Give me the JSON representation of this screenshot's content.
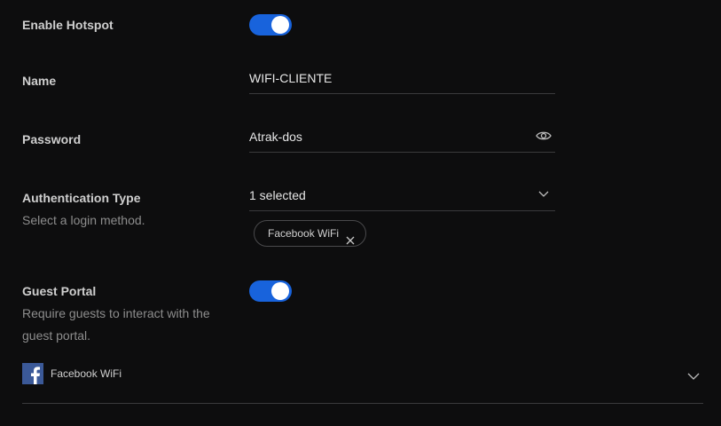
{
  "hotspot": {
    "label": "Enable Hotspot",
    "enabled": true
  },
  "name": {
    "label": "Name",
    "value": "WIFI-CLIENTE"
  },
  "password": {
    "label": "Password",
    "value": "Atrak-dos",
    "icon": "eye-icon"
  },
  "auth": {
    "label": "Authentication Type",
    "description": "Select a login method.",
    "value": "1 selected",
    "icon": "chevron-down-icon",
    "chips": [
      {
        "label": "Facebook WiFi",
        "icon": "close-icon"
      }
    ]
  },
  "guest_portal": {
    "label": "Guest Portal",
    "description_line1": "Require guests to interact with the",
    "description_line2": "guest portal.",
    "enabled": true
  },
  "provider": {
    "name": "Facebook WiFi",
    "icon": "facebook-icon",
    "expand_icon": "chevron-down-icon"
  },
  "colors": {
    "background": "#0d0d0e",
    "toggle_on": "#1863dc",
    "facebook": "#3b5998",
    "divider": "#3a3a3c"
  }
}
